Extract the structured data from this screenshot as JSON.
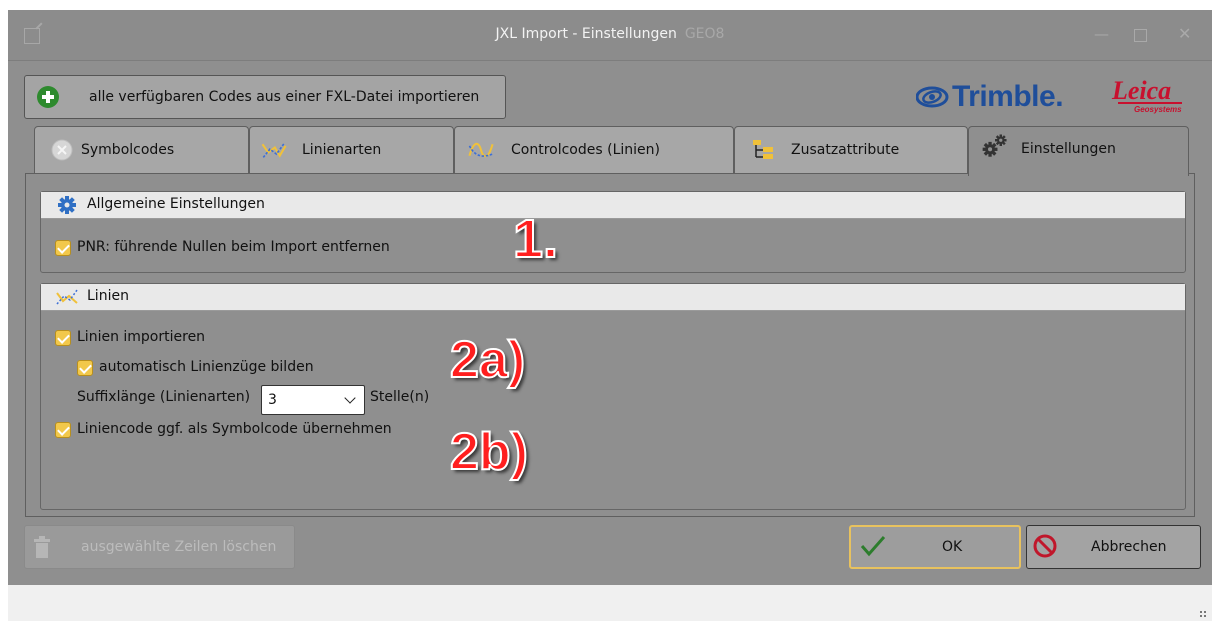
{
  "window": {
    "title": "JXL Import - Einstellungen",
    "title_suffix": "GEO8"
  },
  "toolbar": {
    "import_label": "alle verfügbaren Codes aus einer FXL-Datei importieren"
  },
  "logos": {
    "trimble": "Trimble.",
    "leica": "Leica",
    "leica_sub": "Geosystems"
  },
  "tabs": [
    {
      "label": "Symbolcodes",
      "icon": "circle-x-icon",
      "active": false
    },
    {
      "label": "Linienarten",
      "icon": "line-chart-icon",
      "active": false
    },
    {
      "label": "Controlcodes (Linien)",
      "icon": "curve-chart-icon",
      "active": false
    },
    {
      "label": "Zusatzattribute",
      "icon": "tree-icon",
      "active": false
    },
    {
      "label": "Einstellungen",
      "icon": "gears-icon",
      "active": true
    }
  ],
  "general": {
    "title": "Allgemeine Einstellungen",
    "icon": "gear-icon",
    "pnr_label": "PNR: führende Nullen beim Import entfernen",
    "pnr_checked": true
  },
  "lines": {
    "title": "Linien",
    "icon": "line-chart-icon",
    "import_label": "Linien importieren",
    "import_checked": true,
    "auto_label": "automatisch Linienzüge bilden",
    "auto_checked": true,
    "suffix_label": "Suffixlänge (Linienarten)",
    "suffix_value": "3",
    "suffix_unit": "Stelle(n)",
    "symbol_label": "Liniencode ggf. als Symbolcode übernehmen",
    "symbol_checked": true
  },
  "annotations": {
    "a1": "1.",
    "a2": "2a)",
    "a3": "2b)"
  },
  "buttons": {
    "delete_label": "ausgewählte Zeilen löschen",
    "ok_label": "OK",
    "cancel_label": "Abbrechen"
  },
  "colors": {
    "accent_check": "#f2c84b",
    "ok_border": "#e8c25e",
    "trimble_blue": "#1f4e9a",
    "leica_red": "#c8102e",
    "annotation_red": "#ff1f1f"
  }
}
